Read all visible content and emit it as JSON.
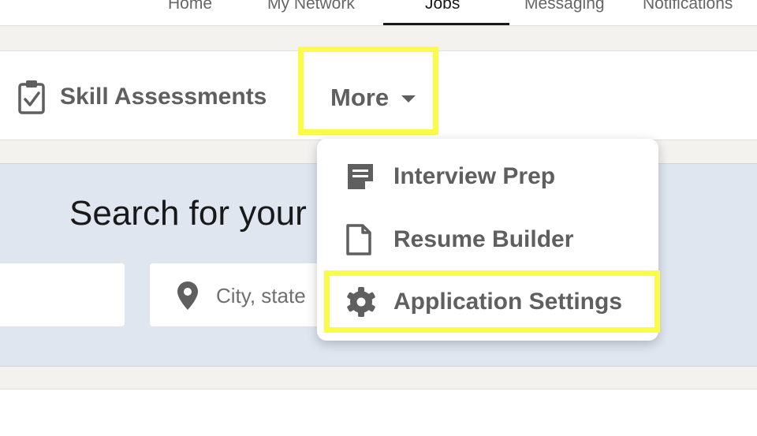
{
  "topnav": {
    "items": [
      {
        "label": "Home"
      },
      {
        "label": "My Network"
      },
      {
        "label": "Jobs"
      },
      {
        "label": "Messaging"
      },
      {
        "label": "Notifications"
      }
    ],
    "active": "Jobs"
  },
  "subnav": {
    "skill_label": "Skill Assessments",
    "more_label": "More"
  },
  "dropdown": {
    "items": [
      {
        "label": "Interview Prep",
        "icon": "interview-prep-icon"
      },
      {
        "label": "Resume Builder",
        "icon": "document-icon"
      },
      {
        "label": "Application Settings",
        "icon": "gear-icon"
      }
    ]
  },
  "hero": {
    "title": "Search for your n",
    "location_placeholder": "City, state"
  },
  "colors": {
    "highlight": "#fbfb4a",
    "hero_bg": "#dfe6f0",
    "text_gray": "#5f5f5f"
  }
}
